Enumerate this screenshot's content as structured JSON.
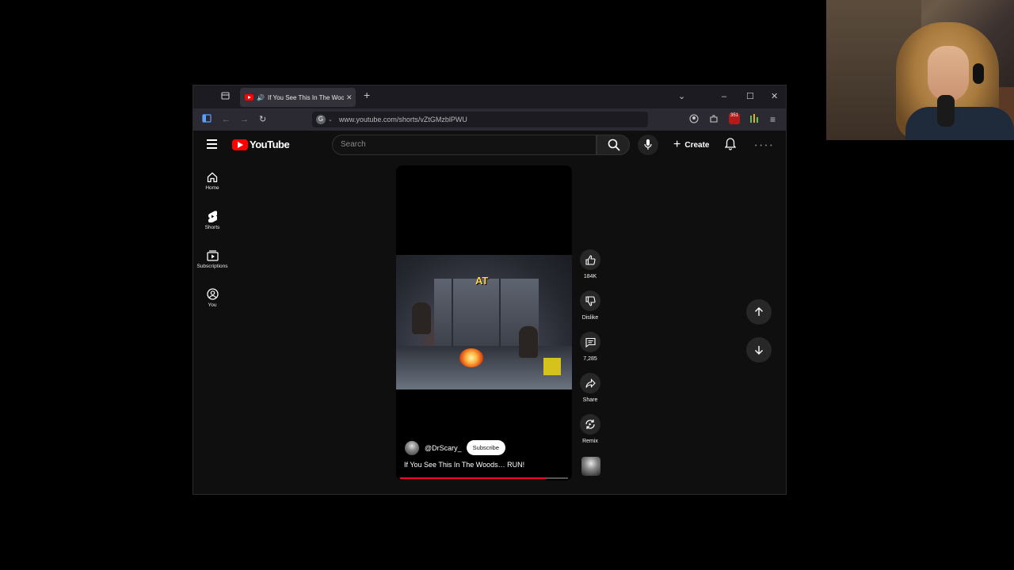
{
  "browser": {
    "tab_title": "If You See This In The Woods... RUN!",
    "url": "www.youtube.com/shorts/vZtGMzblPWU",
    "ext_badge": "351"
  },
  "youtube": {
    "logo_text": "YouTube",
    "search_placeholder": "Search",
    "create_label": "Create",
    "sidebar": [
      {
        "label": "Home",
        "icon": "home-icon"
      },
      {
        "label": "Shorts",
        "icon": "shorts-icon"
      },
      {
        "label": "Subscriptions",
        "icon": "subscriptions-icon"
      },
      {
        "label": "You",
        "icon": "you-icon"
      }
    ],
    "short": {
      "caption": "AT",
      "channel": "@DrScary_",
      "subscribe_label": "Subscribe",
      "title": "If You See This In The Woods… RUN!",
      "progress": 0.87
    },
    "actions": {
      "likes": "184K",
      "dislike_label": "Dislike",
      "comments": "7,285",
      "share_label": "Share",
      "remix_label": "Remix"
    }
  },
  "colors": {
    "brand": "#ff0000",
    "progress": "#ff0033",
    "background": "#0f0f0f"
  }
}
